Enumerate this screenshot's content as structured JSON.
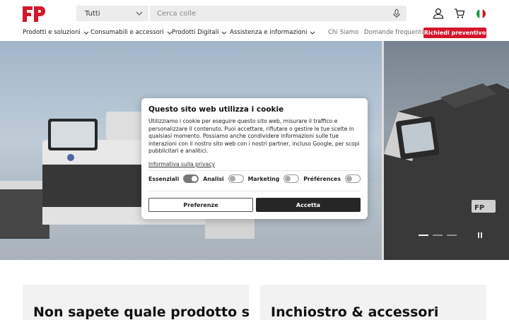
{
  "header": {
    "search_category": "Tutti",
    "search_placeholder": "Cerca colle"
  },
  "nav": {
    "items": [
      "Prodotti e soluzioni",
      "Consumabili e accessori",
      "Prodotti Digitali",
      "Assistenza e informazioni"
    ],
    "links": [
      "Chi Siamo",
      "Domande frequenti"
    ],
    "cta": "Richiedi preventivo"
  },
  "cookie": {
    "title": "Questo sito web utilizza i cookie",
    "text": "Utilizziamo i cookie per eseguire questo sito web, misurare il traffico e personalizzare il contenuto. Puoi accettare, rifiutare o gestire le tue scelte in qualsiasi momento. Possiamo anche condividere informazioni sulle tue interazioni con il nostro sito web con i nostri partner, incluso Google, per scopi pubblicitari e analitici.",
    "policy_link": "Informativa sulla privacy",
    "toggles": [
      {
        "label": "Essenziali",
        "on": true
      },
      {
        "label": "Analisi",
        "on": false
      },
      {
        "label": "Marketing",
        "on": false
      },
      {
        "label": "Préférences",
        "on": false
      }
    ],
    "preferences_button": "Preferenze",
    "accept_button": "Accetta"
  },
  "cards": [
    {
      "title": "Non sapete quale prodotto sia"
    },
    {
      "title": "Inchiostro & accessori"
    }
  ],
  "colors": {
    "brand_red": "#d4162b",
    "dark": "#262626"
  },
  "hero": {
    "active_slide": 1,
    "slide_count": 3
  }
}
